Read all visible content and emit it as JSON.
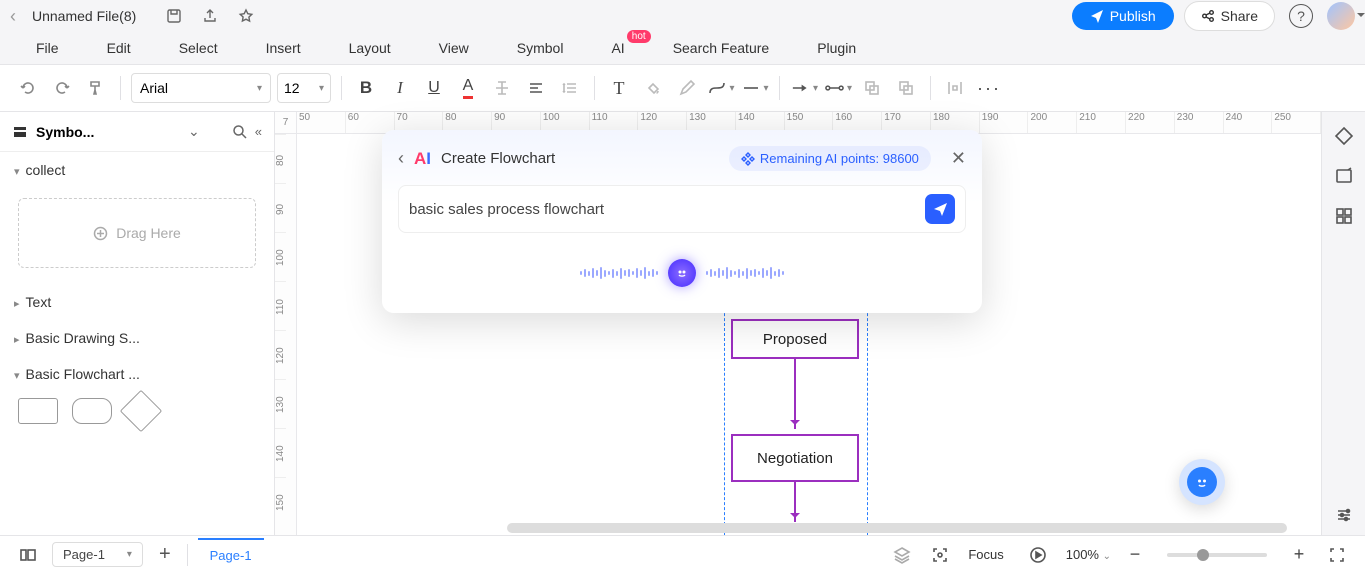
{
  "titlebar": {
    "file_name": "Unnamed File(8)",
    "publish_label": "Publish",
    "share_label": "Share"
  },
  "menu": [
    "File",
    "Edit",
    "Select",
    "Insert",
    "Layout",
    "View",
    "Symbol",
    "AI",
    "Search Feature",
    "Plugin"
  ],
  "menu_hot_badge": "hot",
  "toolbar": {
    "font": "Arial",
    "font_size": "12"
  },
  "left_panel": {
    "title": "Symbo...",
    "sections": {
      "collect": "collect",
      "drag_here": "Drag Here",
      "text": "Text",
      "basic_drawing": "Basic Drawing S...",
      "basic_flowchart": "Basic Flowchart ..."
    }
  },
  "ruler": {
    "corner": "7",
    "h_ticks": [
      "50",
      "60",
      "70",
      "80",
      "90",
      "100",
      "110",
      "120",
      "130",
      "140",
      "150",
      "160",
      "170",
      "180",
      "190",
      "200",
      "210",
      "220",
      "230",
      "240",
      "250"
    ],
    "v_ticks": [
      "80",
      "90",
      "100",
      "110",
      "120",
      "130",
      "140",
      "150"
    ]
  },
  "flow_nodes": {
    "proposed": "Proposed",
    "negotiation": "Negotiation"
  },
  "ai_panel": {
    "title": "Create Flowchart",
    "points_label": "Remaining AI points: 98600",
    "input_value": "basic sales process flowchart"
  },
  "status": {
    "page_select": "Page-1",
    "page_tab": "Page-1",
    "focus_label": "Focus",
    "zoom": "100%"
  }
}
